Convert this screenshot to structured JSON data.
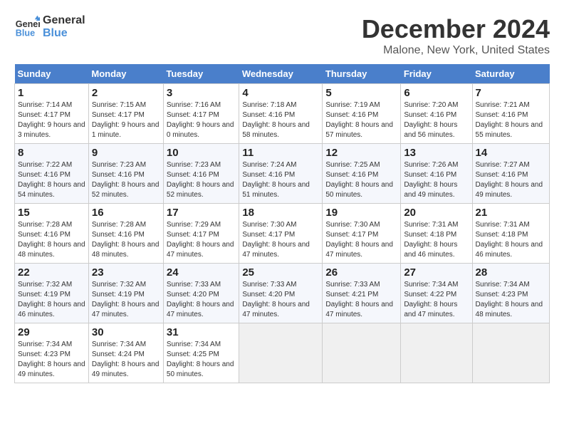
{
  "logo": {
    "line1": "General",
    "line2": "Blue"
  },
  "title": "December 2024",
  "subtitle": "Malone, New York, United States",
  "days_of_week": [
    "Sunday",
    "Monday",
    "Tuesday",
    "Wednesday",
    "Thursday",
    "Friday",
    "Saturday"
  ],
  "weeks": [
    [
      {
        "day": "1",
        "sunrise": "7:14 AM",
        "sunset": "4:17 PM",
        "daylight": "9 hours and 3 minutes."
      },
      {
        "day": "2",
        "sunrise": "7:15 AM",
        "sunset": "4:17 PM",
        "daylight": "9 hours and 1 minute."
      },
      {
        "day": "3",
        "sunrise": "7:16 AM",
        "sunset": "4:17 PM",
        "daylight": "9 hours and 0 minutes."
      },
      {
        "day": "4",
        "sunrise": "7:18 AM",
        "sunset": "4:16 PM",
        "daylight": "8 hours and 58 minutes."
      },
      {
        "day": "5",
        "sunrise": "7:19 AM",
        "sunset": "4:16 PM",
        "daylight": "8 hours and 57 minutes."
      },
      {
        "day": "6",
        "sunrise": "7:20 AM",
        "sunset": "4:16 PM",
        "daylight": "8 hours and 56 minutes."
      },
      {
        "day": "7",
        "sunrise": "7:21 AM",
        "sunset": "4:16 PM",
        "daylight": "8 hours and 55 minutes."
      }
    ],
    [
      {
        "day": "8",
        "sunrise": "7:22 AM",
        "sunset": "4:16 PM",
        "daylight": "8 hours and 54 minutes."
      },
      {
        "day": "9",
        "sunrise": "7:23 AM",
        "sunset": "4:16 PM",
        "daylight": "8 hours and 52 minutes."
      },
      {
        "day": "10",
        "sunrise": "7:23 AM",
        "sunset": "4:16 PM",
        "daylight": "8 hours and 52 minutes."
      },
      {
        "day": "11",
        "sunrise": "7:24 AM",
        "sunset": "4:16 PM",
        "daylight": "8 hours and 51 minutes."
      },
      {
        "day": "12",
        "sunrise": "7:25 AM",
        "sunset": "4:16 PM",
        "daylight": "8 hours and 50 minutes."
      },
      {
        "day": "13",
        "sunrise": "7:26 AM",
        "sunset": "4:16 PM",
        "daylight": "8 hours and 49 minutes."
      },
      {
        "day": "14",
        "sunrise": "7:27 AM",
        "sunset": "4:16 PM",
        "daylight": "8 hours and 49 minutes."
      }
    ],
    [
      {
        "day": "15",
        "sunrise": "7:28 AM",
        "sunset": "4:16 PM",
        "daylight": "8 hours and 48 minutes."
      },
      {
        "day": "16",
        "sunrise": "7:28 AM",
        "sunset": "4:16 PM",
        "daylight": "8 hours and 48 minutes."
      },
      {
        "day": "17",
        "sunrise": "7:29 AM",
        "sunset": "4:17 PM",
        "daylight": "8 hours and 47 minutes."
      },
      {
        "day": "18",
        "sunrise": "7:30 AM",
        "sunset": "4:17 PM",
        "daylight": "8 hours and 47 minutes."
      },
      {
        "day": "19",
        "sunrise": "7:30 AM",
        "sunset": "4:17 PM",
        "daylight": "8 hours and 47 minutes."
      },
      {
        "day": "20",
        "sunrise": "7:31 AM",
        "sunset": "4:18 PM",
        "daylight": "8 hours and 46 minutes."
      },
      {
        "day": "21",
        "sunrise": "7:31 AM",
        "sunset": "4:18 PM",
        "daylight": "8 hours and 46 minutes."
      }
    ],
    [
      {
        "day": "22",
        "sunrise": "7:32 AM",
        "sunset": "4:19 PM",
        "daylight": "8 hours and 46 minutes."
      },
      {
        "day": "23",
        "sunrise": "7:32 AM",
        "sunset": "4:19 PM",
        "daylight": "8 hours and 47 minutes."
      },
      {
        "day": "24",
        "sunrise": "7:33 AM",
        "sunset": "4:20 PM",
        "daylight": "8 hours and 47 minutes."
      },
      {
        "day": "25",
        "sunrise": "7:33 AM",
        "sunset": "4:20 PM",
        "daylight": "8 hours and 47 minutes."
      },
      {
        "day": "26",
        "sunrise": "7:33 AM",
        "sunset": "4:21 PM",
        "daylight": "8 hours and 47 minutes."
      },
      {
        "day": "27",
        "sunrise": "7:34 AM",
        "sunset": "4:22 PM",
        "daylight": "8 hours and 47 minutes."
      },
      {
        "day": "28",
        "sunrise": "7:34 AM",
        "sunset": "4:23 PM",
        "daylight": "8 hours and 48 minutes."
      }
    ],
    [
      {
        "day": "29",
        "sunrise": "7:34 AM",
        "sunset": "4:23 PM",
        "daylight": "8 hours and 49 minutes."
      },
      {
        "day": "30",
        "sunrise": "7:34 AM",
        "sunset": "4:24 PM",
        "daylight": "8 hours and 49 minutes."
      },
      {
        "day": "31",
        "sunrise": "7:34 AM",
        "sunset": "4:25 PM",
        "daylight": "8 hours and 50 minutes."
      },
      null,
      null,
      null,
      null
    ]
  ],
  "labels": {
    "sunrise": "Sunrise:",
    "sunset": "Sunset:",
    "daylight": "Daylight:"
  }
}
